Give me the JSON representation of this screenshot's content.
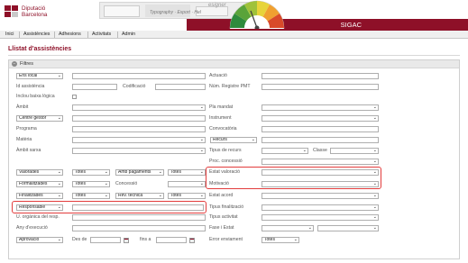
{
  "header": {
    "logo_line1": "Diputació",
    "logo_line2": "Barcelona",
    "collage_text": "Typography · Export · Hel",
    "collage_text2": "esigner",
    "app_name": "SIGAC"
  },
  "menu": [
    "Inici",
    "Assistències",
    "Adhesions",
    "Activitats",
    "Admin"
  ],
  "page": {
    "title": "Llistat d'assistències"
  },
  "filters": {
    "title": "Filtres",
    "labels": {
      "id": "Id assistència",
      "codificacio": "Codificació",
      "baixa": "Inclou baixa lògica",
      "ambit": "Àmbit",
      "programa": "Programa",
      "materia": "Matèria",
      "ambit_sarxa": "Àmbit xarxa",
      "uorg": "U. orgànica del resp.",
      "any": "Any d'execució",
      "des_de": "Des de",
      "fins_a": "fins a",
      "actuacio": "Actuació",
      "num_pmt": "Núm. Registre PMT",
      "pla": "Pla mandat",
      "instrument": "Instrument",
      "convocatoria": "Convocatòria",
      "tipus_recurs": "Tipus de recurs",
      "classe": "Classe",
      "proc": "Proc. concessió",
      "concessio": "Concessió",
      "estat_val": "Estat valoració",
      "motivacio": "Motivació",
      "estat_acord": "Estat acord",
      "tipus_fin": "Tipus finalització",
      "tipus_act": "Tipus activitat",
      "fase": "Fase i Estat",
      "error_env": "Error enviament"
    },
    "selects": {
      "ens": "Ens local",
      "gestor": "Centre gestor",
      "recurs": "Recurs",
      "valorades": "Valorades",
      "totes": "Totes",
      "amb_pagaments": "Amb pagaments",
      "formalitzades": "Formalitzades",
      "finalitzades": "Finalitzades",
      "rev_tecnica": "Rev. tècnica",
      "responsable": "Responsable",
      "aprovacio": "Aprovació"
    }
  }
}
